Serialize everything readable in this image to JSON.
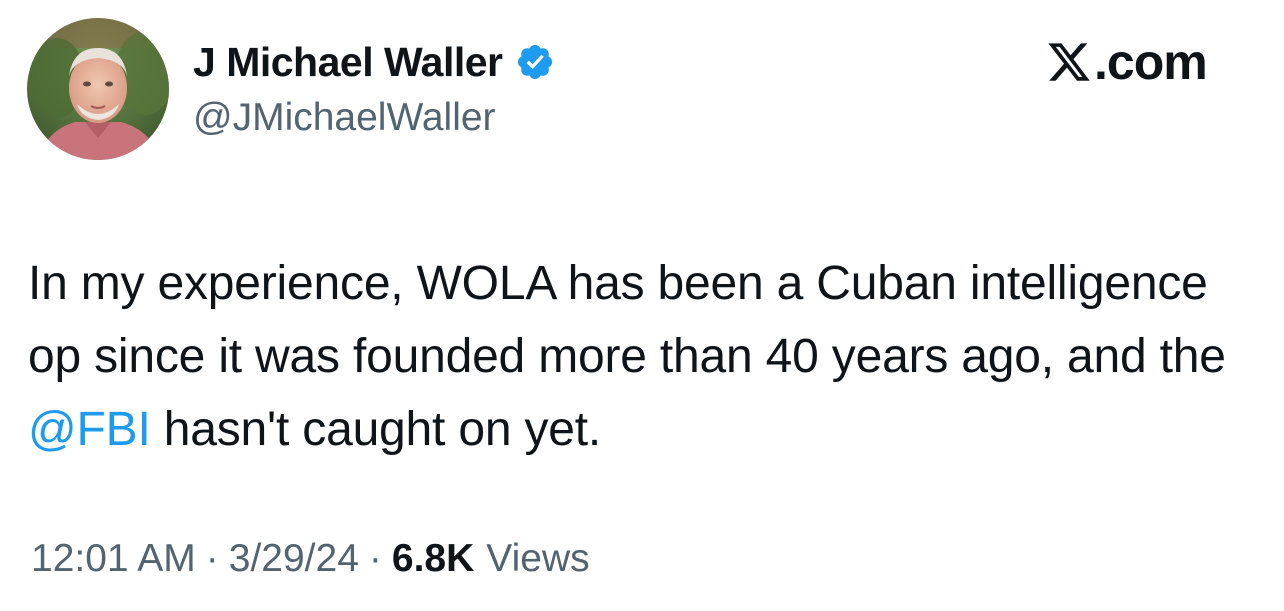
{
  "author": {
    "display_name": "J Michael Waller",
    "handle": "@JMichaelWaller",
    "verified": true,
    "avatar_icon": "profile-photo"
  },
  "brand": {
    "logo_text": ".com",
    "logo_icon": "x-logo-icon",
    "color": "#0f1419"
  },
  "tweet": {
    "text_before": "In my experience, WOLA has been a Cuban intelligence op since it was founded more than 40 years ago, and the ",
    "mention": "@FBI",
    "text_after": " hasn't caught on yet."
  },
  "meta": {
    "time": "12:01 AM",
    "separator": "·",
    "date": "3/29/24",
    "views_count": "6.8K",
    "views_label": "Views"
  },
  "colors": {
    "text": "#0f1419",
    "secondary": "#536471",
    "link": "#1d9bf0",
    "verified": "#1d9bf0"
  }
}
